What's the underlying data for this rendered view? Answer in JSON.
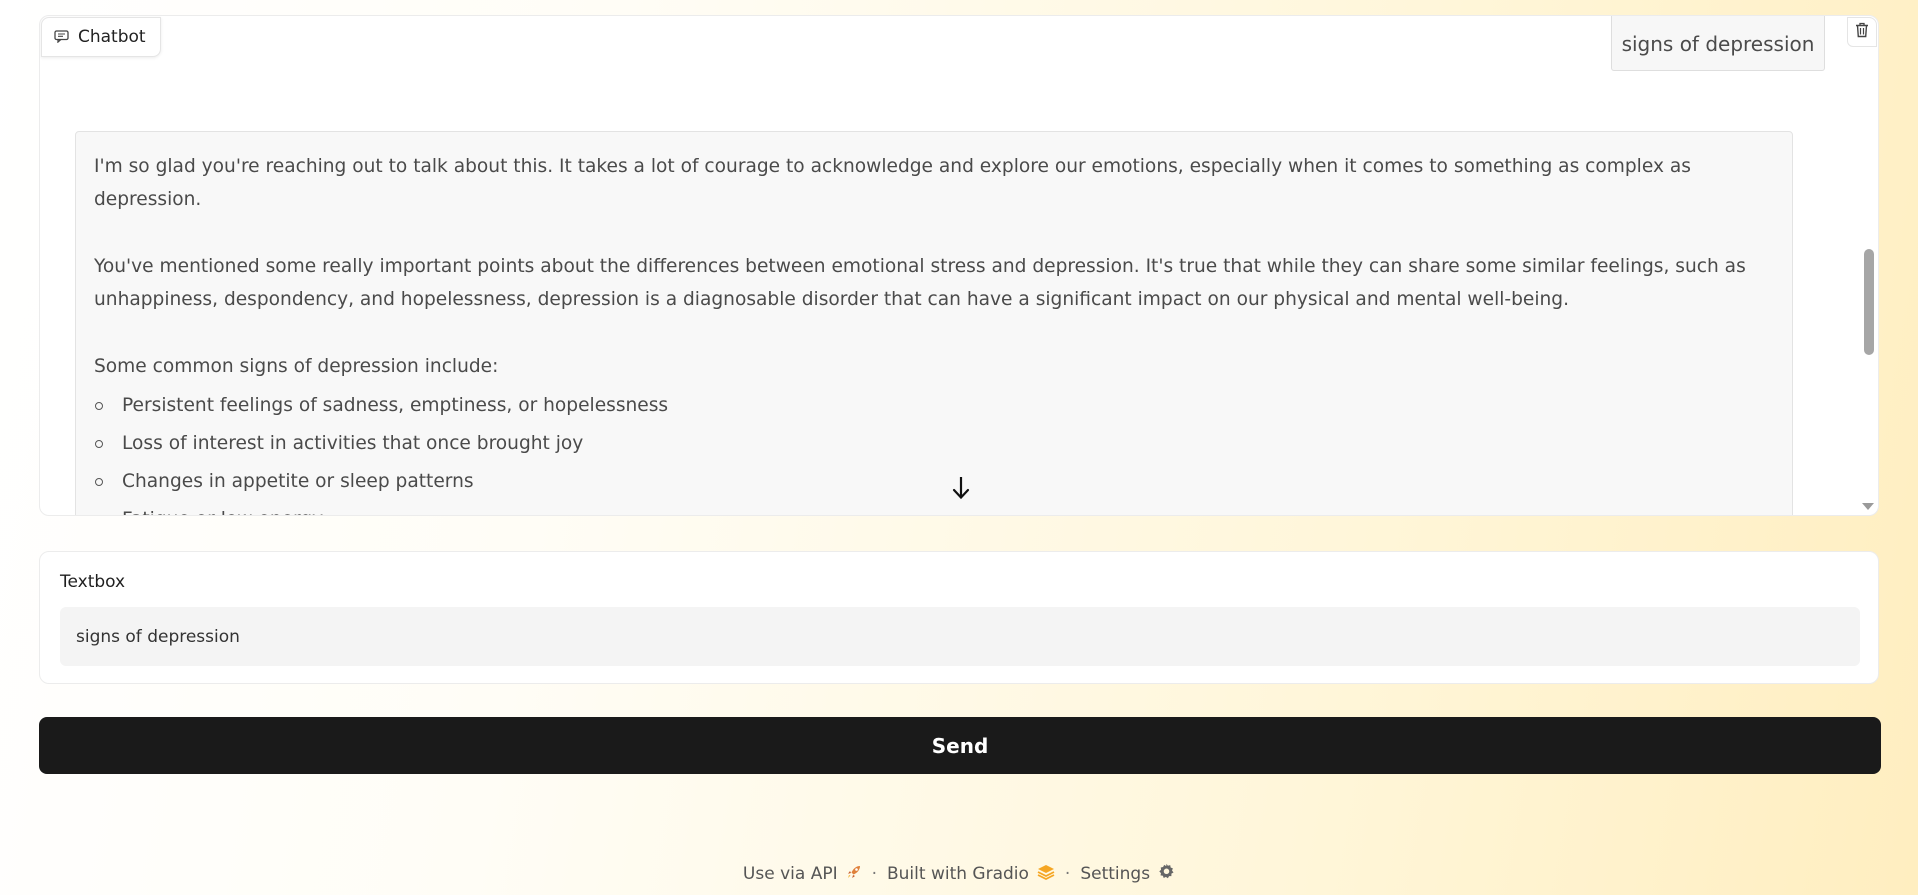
{
  "chatbot": {
    "label": "Chatbot",
    "icon": "chat-icon",
    "clear_icon": "trash-icon",
    "user_message": "signs of depression",
    "bot_message": {
      "paragraphs": [
        "I'm so glad you're reaching out to talk about this. It takes a lot of courage to acknowledge and explore our emotions, especially when it comes to something as complex as depression.",
        "You've mentioned some really important points about the differences between emotional stress and depression. It's true that while they can share some similar feelings, such as unhappiness, despondency, and hopelessness, depression is a diagnosable disorder that can have a significant impact on our physical and mental well-being.",
        "Some common signs of depression include:"
      ],
      "list_items": [
        "Persistent feelings of sadness, emptiness, or hopelessness",
        "Loss of interest in activities that once brought joy",
        "Changes in appetite or sleep patterns",
        "Fatigue or low energy"
      ]
    },
    "scroll_down_icon": "arrow-down-icon"
  },
  "textbox": {
    "label": "Textbox",
    "value": "signs of depression"
  },
  "send_button": {
    "label": "Send"
  },
  "footer": {
    "api_link": "Use via API",
    "api_icon": "rocket-icon",
    "separator": "·",
    "built_with": "Built with Gradio",
    "gradio_icon": "gradio-logo-icon",
    "settings": "Settings",
    "settings_icon": "gear-icon"
  },
  "colors": {
    "send_bg": "#1a1a1a",
    "gradio_orange": "#f5a623"
  }
}
